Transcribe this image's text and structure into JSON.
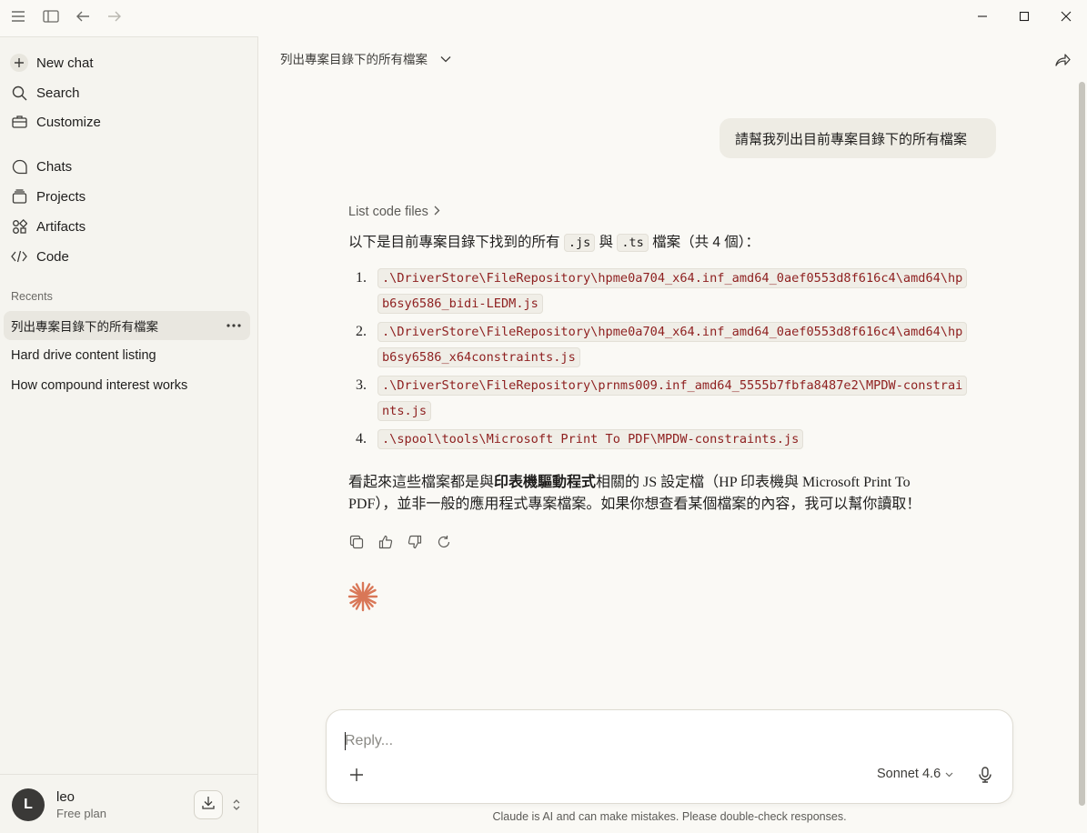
{
  "sidebar": {
    "nav": [
      {
        "label": "New chat",
        "icon": "plus-icon"
      },
      {
        "label": "Search",
        "icon": "search-icon"
      },
      {
        "label": "Customize",
        "icon": "briefcase-icon"
      },
      {
        "label": "Chats",
        "icon": "chat-bubble-icon"
      },
      {
        "label": "Projects",
        "icon": "folder-stack-icon"
      },
      {
        "label": "Artifacts",
        "icon": "artifacts-icon"
      },
      {
        "label": "Code",
        "icon": "code-icon"
      }
    ],
    "recents_label": "Recents",
    "recents": [
      {
        "label": "列出專案目錄下的所有檔案",
        "active": true
      },
      {
        "label": "Hard drive content listing",
        "active": false
      },
      {
        "label": "How compound interest works",
        "active": false
      }
    ],
    "user": {
      "initial": "L",
      "name": "leo",
      "plan": "Free plan"
    }
  },
  "header": {
    "chat_title": "列出專案目錄下的所有檔案"
  },
  "conversation": {
    "user_message": "請幫我列出目前專案目錄下的所有檔案",
    "tool_label": "List code files",
    "intro_prefix": "以下是目前專案目錄下找到的所有",
    "intro_ext1": ".js",
    "intro_and": "與",
    "intro_ext2": ".ts",
    "intro_suffix": "檔案（共 4 個）：",
    "files": [
      {
        "num": "1.",
        "path": ".\\DriverStore\\FileRepository\\hpme0a704_x64.inf_amd64_0aef0553d8f616c4\\amd64\\hpb6sy6586_bidi-LEDM.js"
      },
      {
        "num": "2.",
        "path": ".\\DriverStore\\FileRepository\\hpme0a704_x64.inf_amd64_0aef0553d8f616c4\\amd64\\hpb6sy6586_x64constraints.js"
      },
      {
        "num": "3.",
        "path": ".\\DriverStore\\FileRepository\\prnms009.inf_amd64_5555b7fbfa8487e2\\MPDW-constraints.js"
      },
      {
        "num": "4.",
        "path": ".\\spool\\tools\\Microsoft Print To PDF\\MPDW-constraints.js"
      }
    ],
    "summary_prefix": "看起來這些檔案都是與",
    "summary_bold": "印表機驅動程式",
    "summary_suffix": "相關的 JS 設定檔（HP 印表機與 Microsoft Print To PDF），並非一般的應用程式專案檔案。如果你想查看某個檔案的內容，我可以幫你讀取！"
  },
  "composer": {
    "placeholder": "Reply...",
    "model": "Sonnet 4.6"
  },
  "disclaimer": "Claude is AI and can make mistakes. Please double-check responses.",
  "colors": {
    "background": "#faf9f5",
    "sidebar": "#f5f4ef",
    "accent": "#d97757",
    "code_text": "#8e1f1f"
  }
}
